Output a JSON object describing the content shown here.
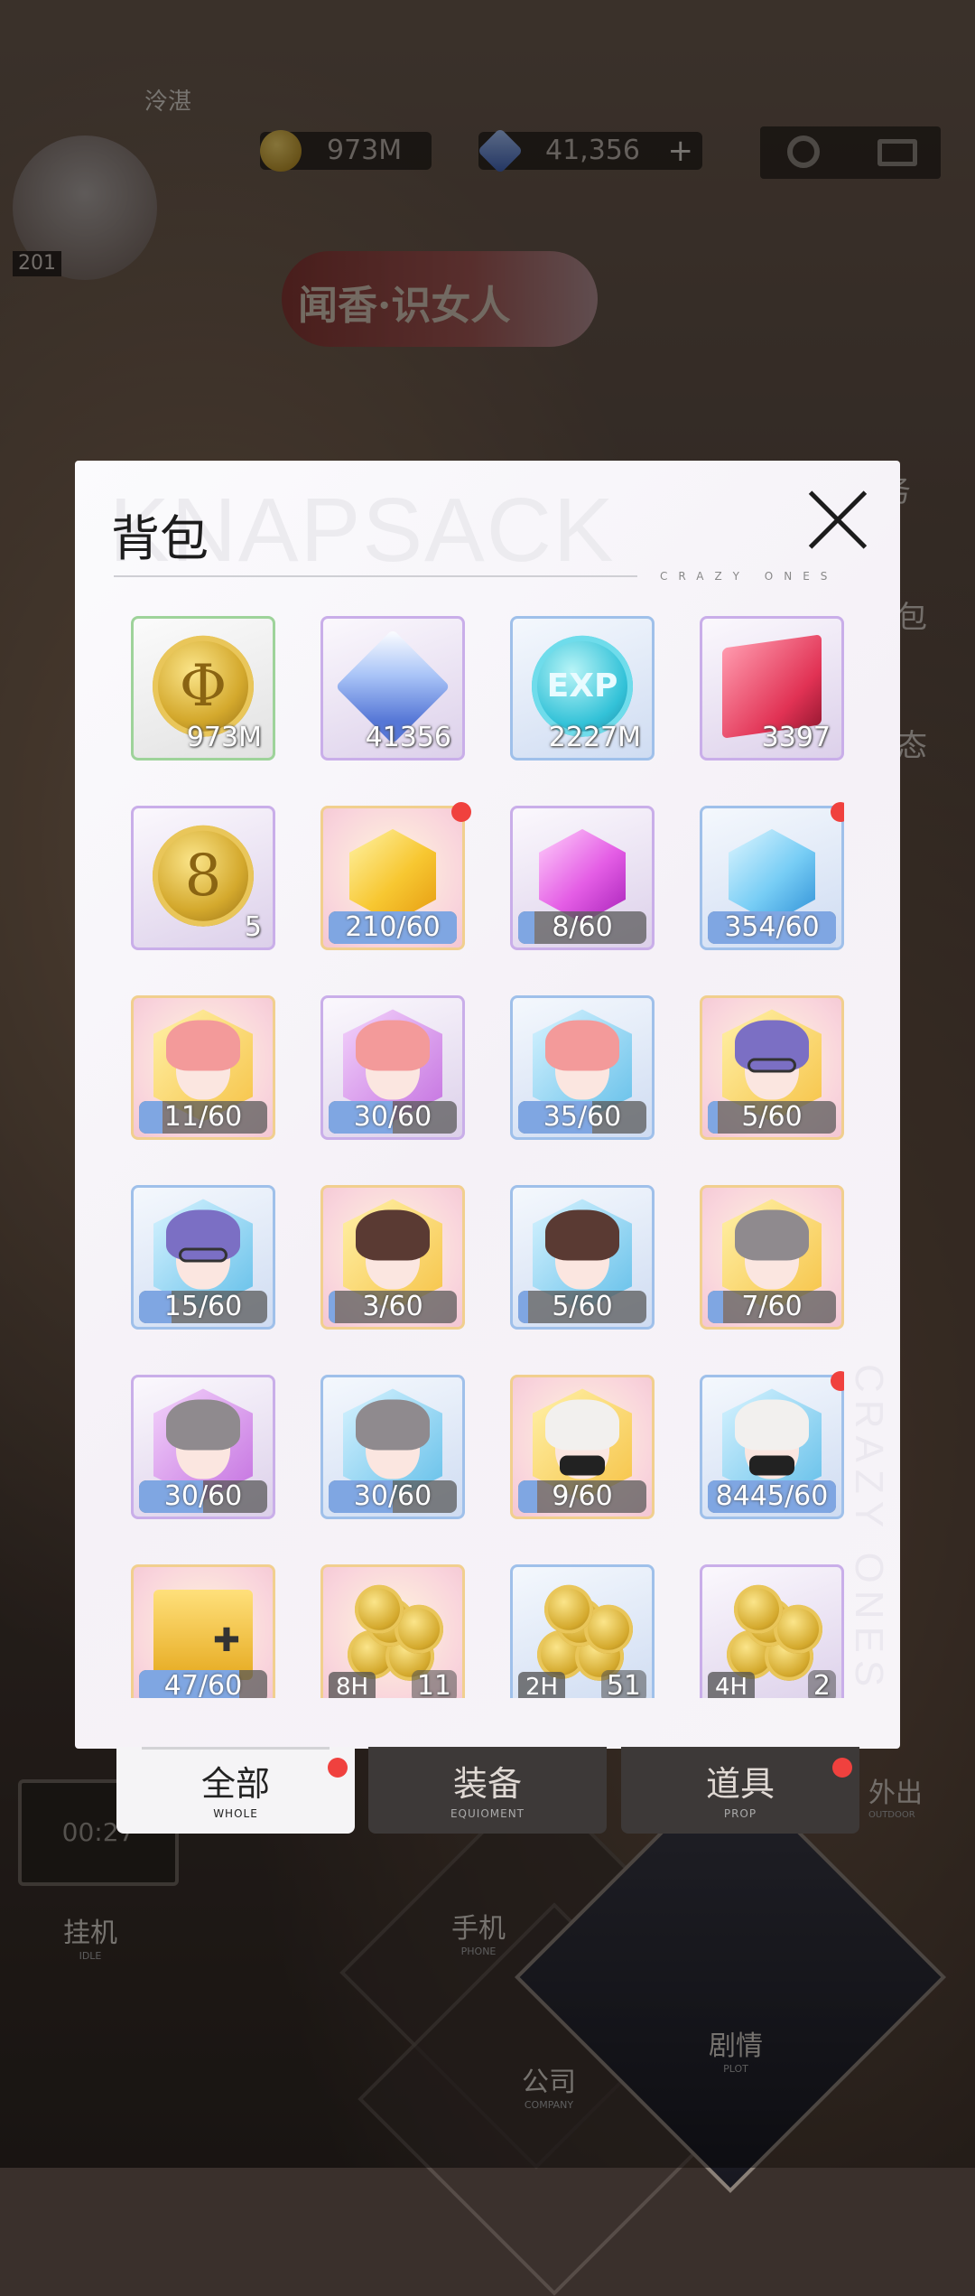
{
  "header": {
    "player_name": "泠湛",
    "level": "201",
    "gold": "973M",
    "diamonds": "41,356",
    "plus": "+",
    "event_banner": "闻香·识女人"
  },
  "background": {
    "side_labels": [
      "务",
      "包",
      "态",
      "外出"
    ],
    "side_label_sub": "OUTDOOR",
    "laptop_time": "00:27",
    "nav": [
      {
        "label": "挂机",
        "sub": "IDLE"
      },
      {
        "label": "手机",
        "sub": "PHONE"
      },
      {
        "label": "公司",
        "sub": "COMPANY"
      },
      {
        "label": "剧情",
        "sub": "PLOT"
      }
    ]
  },
  "modal": {
    "title": "背包",
    "watermark": "KNAPSACK",
    "subtitle": "CRAZY ONES",
    "side_watermark": "CRAZY ONES"
  },
  "items": [
    {
      "kind": "coin",
      "glyph": "Φ",
      "frame": "green",
      "count": "973M"
    },
    {
      "kind": "diamond",
      "frame": "purple",
      "count": "41356"
    },
    {
      "kind": "exp",
      "glyph": "EXP",
      "frame": "blue",
      "count": "2227M"
    },
    {
      "kind": "cube",
      "frame": "purple",
      "count": "3397"
    },
    {
      "kind": "coin",
      "glyph": "8",
      "frame": "purple",
      "count": "5"
    },
    {
      "kind": "crystal-gold",
      "frame": "gold",
      "progress": "210/60",
      "fill": 1.0,
      "dot": true
    },
    {
      "kind": "crystal-pink",
      "frame": "purple",
      "progress": "8/60",
      "fill": 0.13
    },
    {
      "kind": "crystal-blue",
      "frame": "blue",
      "progress": "354/60",
      "fill": 1.0,
      "dot": true
    },
    {
      "kind": "portrait",
      "hair": "#f39a9a",
      "bg": "gold",
      "frame": "gold",
      "progress": "11/60",
      "fill": 0.18
    },
    {
      "kind": "portrait",
      "hair": "#f39a9a",
      "bg": "purple",
      "frame": "purple",
      "progress": "30/60",
      "fill": 0.5
    },
    {
      "kind": "portrait",
      "hair": "#f39a9a",
      "bg": "blue",
      "frame": "blue",
      "progress": "35/60",
      "fill": 0.58
    },
    {
      "kind": "portrait",
      "hair": "#7b6fc4",
      "glasses": true,
      "bg": "gold",
      "frame": "gold",
      "progress": "5/60",
      "fill": 0.08
    },
    {
      "kind": "portrait",
      "hair": "#7b6fc4",
      "glasses": true,
      "bg": "blue",
      "frame": "blue",
      "progress": "15/60",
      "fill": 0.25
    },
    {
      "kind": "portrait",
      "hair": "#5a3a33",
      "bg": "gold",
      "frame": "gold",
      "progress": "3/60",
      "fill": 0.05
    },
    {
      "kind": "portrait",
      "hair": "#5a3a33",
      "bg": "blue",
      "frame": "blue",
      "progress": "5/60",
      "fill": 0.08
    },
    {
      "kind": "portrait",
      "hair": "#8f8a8e",
      "bg": "gold",
      "frame": "gold",
      "progress": "7/60",
      "fill": 0.12
    },
    {
      "kind": "portrait",
      "hair": "#8f8a8e",
      "bg": "purple",
      "frame": "purple",
      "progress": "30/60",
      "fill": 0.5
    },
    {
      "kind": "portrait",
      "hair": "#8f8a8e",
      "bg": "blue",
      "frame": "blue",
      "progress": "30/60",
      "fill": 0.5
    },
    {
      "kind": "portrait",
      "hair": "#f2f0ee",
      "mask": true,
      "bg": "gold",
      "frame": "gold",
      "progress": "9/60",
      "fill": 0.15
    },
    {
      "kind": "portrait",
      "hair": "#f2f0ee",
      "mask": true,
      "bg": "blue",
      "frame": "blue",
      "progress": "8445/60",
      "fill": 1.0,
      "dot": true
    },
    {
      "kind": "chest",
      "frame": "gold",
      "progress": "47/60",
      "fill": 0.78
    },
    {
      "kind": "coinpile",
      "frame": "gold",
      "tag": "8H",
      "count": "11"
    },
    {
      "kind": "coinpile",
      "frame": "blue",
      "tag": "2H",
      "count": "51"
    },
    {
      "kind": "coinpile",
      "frame": "purple",
      "tag": "4H",
      "count": "2"
    }
  ],
  "tabs": [
    {
      "label": "全部",
      "sub": "WHOLE",
      "active": true,
      "dot": true
    },
    {
      "label": "装备",
      "sub": "EQUIOMENT",
      "active": false,
      "dot": false
    },
    {
      "label": "道具",
      "sub": "PROP",
      "active": false,
      "dot": true
    }
  ],
  "colors": {
    "accent_dot": "#f0413e",
    "progress_fill": "#7fa6e2",
    "frame_green": "#9ed39a",
    "frame_purple": "#c9aee9",
    "frame_blue": "#9fc0ea",
    "frame_gold": "#f1cf8e"
  }
}
